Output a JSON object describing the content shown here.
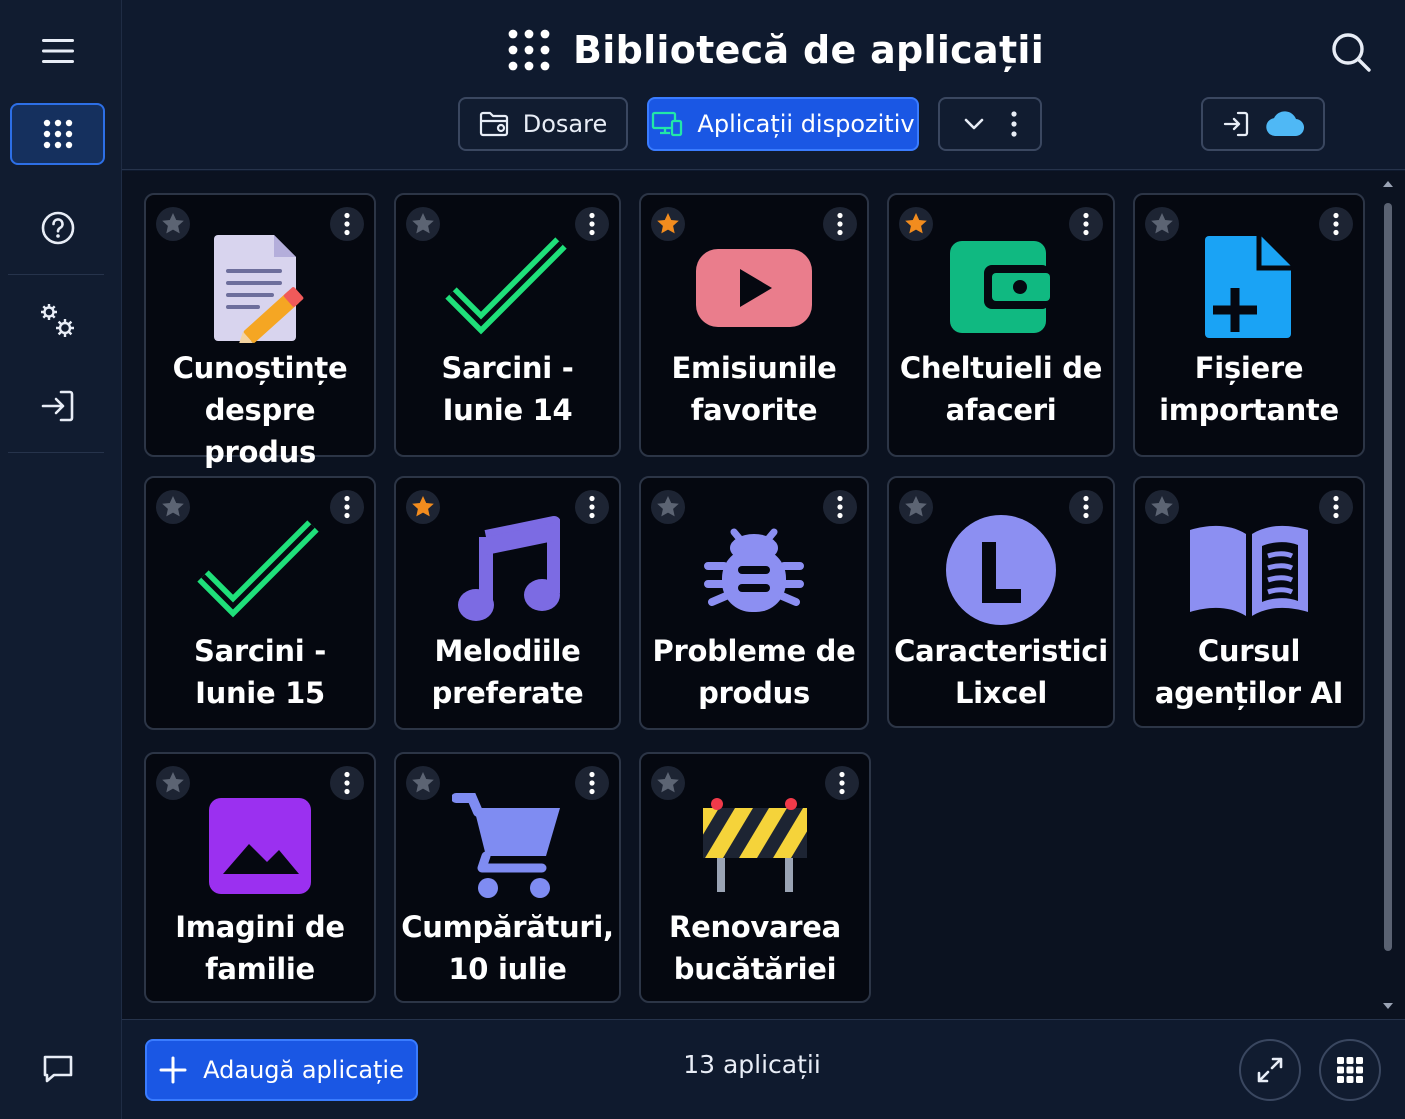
{
  "header": {
    "title": "Bibliotecă de aplicații",
    "tabs": [
      {
        "label": "Dosare",
        "active": false
      },
      {
        "label": "Aplicații dispozitiv",
        "active": true
      }
    ]
  },
  "sidebar": {
    "items": [
      {
        "icon": "menu-icon"
      },
      {
        "icon": "apps-grid-icon",
        "active": true
      },
      {
        "icon": "help-icon"
      },
      {
        "icon": "settings-gears-icon"
      },
      {
        "icon": "sign-in-icon"
      },
      {
        "icon": "chat-icon"
      }
    ]
  },
  "apps": [
    {
      "label": "Cunoștințe despre produs",
      "icon": "document-edit-icon",
      "favorite": false
    },
    {
      "label": "Sarcini - Iunie 14",
      "icon": "checkmark-icon",
      "favorite": false
    },
    {
      "label": "Emisiunile favorite",
      "icon": "video-play-icon",
      "favorite": true
    },
    {
      "label": "Cheltuieli de afaceri",
      "icon": "wallet-icon",
      "favorite": true
    },
    {
      "label": "Fișiere importante",
      "icon": "file-add-icon",
      "favorite": false
    },
    {
      "label": "Sarcini - Iunie 15",
      "icon": "checkmark-icon",
      "favorite": false
    },
    {
      "label": "Melodiile preferate",
      "icon": "music-note-icon",
      "favorite": true
    },
    {
      "label": "Probleme de produs",
      "icon": "bug-icon",
      "favorite": false
    },
    {
      "label": "Caracteristici Lixcel",
      "icon": "letter-l-icon",
      "favorite": false
    },
    {
      "label": "Cursul agenților AI",
      "icon": "open-book-icon",
      "favorite": false
    },
    {
      "label": "Imagini de familie",
      "icon": "image-icon",
      "favorite": false
    },
    {
      "label": "Cumpărături, 10 iulie",
      "icon": "shopping-cart-icon",
      "favorite": false
    },
    {
      "label": "Renovarea bucătăriei",
      "icon": "construction-barrier-icon",
      "favorite": false
    }
  ],
  "footer": {
    "add_label": "Adaugă aplicație",
    "count_text": "13 aplicații"
  },
  "colors": {
    "accent": "#1a57e4",
    "favorite_star": "#f28c1e",
    "check": "#1fe07a",
    "video": "#ea7d8c",
    "wallet": "#10b981",
    "file": "#1aa3f5",
    "music": "#7c6be3",
    "bug": "#8c8ff2",
    "image": "#9b30f0"
  }
}
